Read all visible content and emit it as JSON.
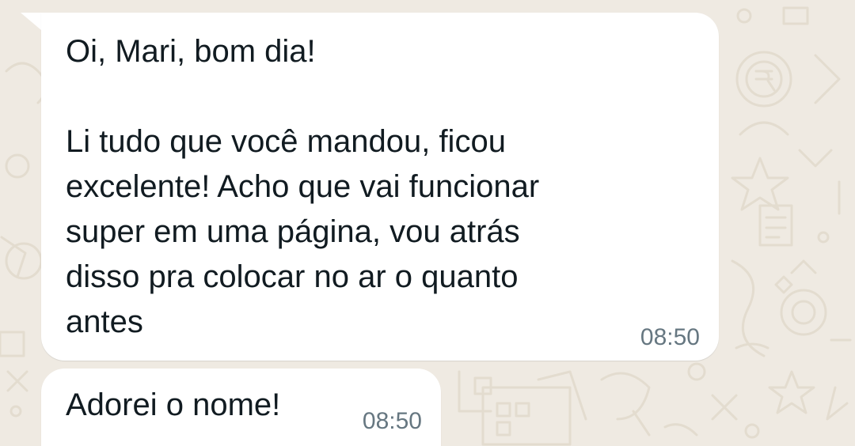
{
  "chat": {
    "messages": [
      {
        "text": "Oi, Mari, bom dia!\n\nLi tudo que você mandou, ficou\nexcelente! Acho que vai funcionar\nsuper em uma página, vou atrás\ndisso pra colocar no ar o quanto\nantes",
        "time": "08:50"
      },
      {
        "text": "Adorei o nome!",
        "time": "08:50"
      }
    ]
  },
  "colors": {
    "wallpaper": "#efeae2",
    "doodle": "#e3dccf",
    "bubble": "#ffffff",
    "text": "#111b21",
    "timestamp": "#667781"
  },
  "icons": [
    "wallpaper-doodle-pattern"
  ]
}
